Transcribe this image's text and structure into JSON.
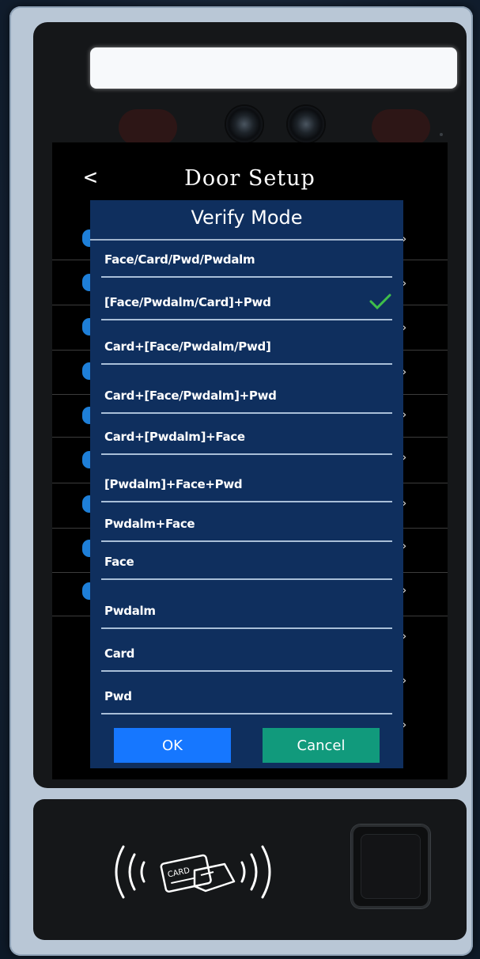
{
  "screen": {
    "back_glyph": "<",
    "title": "Door Setup"
  },
  "dialog": {
    "title": "Verify Mode",
    "options": [
      {
        "label": "Face/Card/Pwd/Pwdalm",
        "selected": false
      },
      {
        "label": "[Face/Pwdalm/Card]+Pwd",
        "selected": true
      },
      {
        "label": "Card+[Face/Pwdalm/Pwd]",
        "selected": false
      },
      {
        "label": "Card+[Face/Pwdalm]+Pwd",
        "selected": false
      },
      {
        "label": "Card+[Pwdalm]+Face",
        "selected": false
      },
      {
        "label": "[Pwdalm]+Face+Pwd",
        "selected": false
      },
      {
        "label": "Pwdalm+Face",
        "selected": false
      },
      {
        "label": "Face",
        "selected": false
      },
      {
        "label": "Pwdalm",
        "selected": false
      },
      {
        "label": "Card",
        "selected": false
      },
      {
        "label": "Pwd",
        "selected": false
      }
    ],
    "ok_label": "OK",
    "cancel_label": "Cancel"
  },
  "reader": {
    "card_text": "CARD"
  },
  "colors": {
    "dialog_bg": "#0f2f5e",
    "ok_button": "#1677ff",
    "cancel_button": "#119a7c",
    "check_mark": "#3fbf4a"
  },
  "icons": [
    "back-arrow-icon",
    "check-icon",
    "chevron-right-icon",
    "nfc-card-icon",
    "fingerprint-sensor-icon",
    "camera-icon"
  ]
}
